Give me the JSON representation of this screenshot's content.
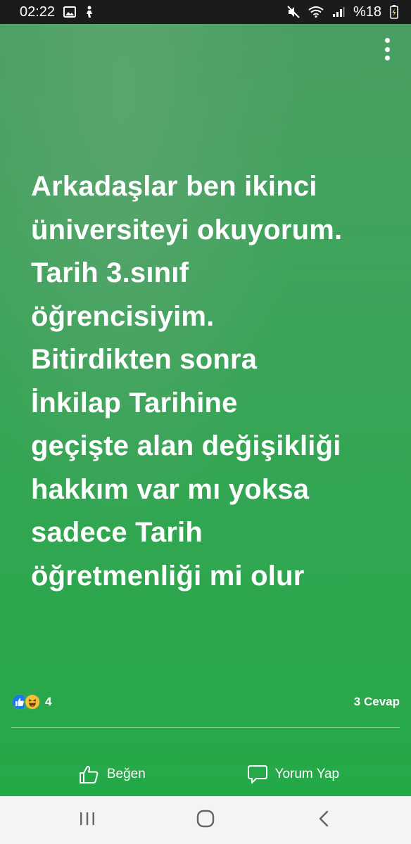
{
  "status_bar": {
    "time": "02:22",
    "battery": "%18",
    "icons": [
      "image-icon",
      "person-walking-icon",
      "mute-icon",
      "wifi-icon",
      "signal-icon",
      "battery-icon"
    ]
  },
  "story": {
    "background_colors": [
      "#4a9e62",
      "#24a948"
    ],
    "text": "Arkadaşlar ben ikinci\nüniversiteyi okuyorum.\nTarih 3.sınıf\nöğrencisiyim.\nBitirdikten sonra\nİnkilap Tarihine\ngeçişte alan değişikliği\nhakkım var mı yoksa\nsadece Tarih\nöğretmenliği mi olur"
  },
  "reactions": {
    "types": [
      "like-reaction-icon",
      "haha-reaction-icon"
    ],
    "count": "4",
    "replies": "3 Cevap"
  },
  "actions": {
    "like_label": "Beğen",
    "comment_label": "Yorum Yap"
  },
  "nav": {
    "icons": [
      "recent-apps-icon",
      "home-icon",
      "back-icon"
    ]
  }
}
